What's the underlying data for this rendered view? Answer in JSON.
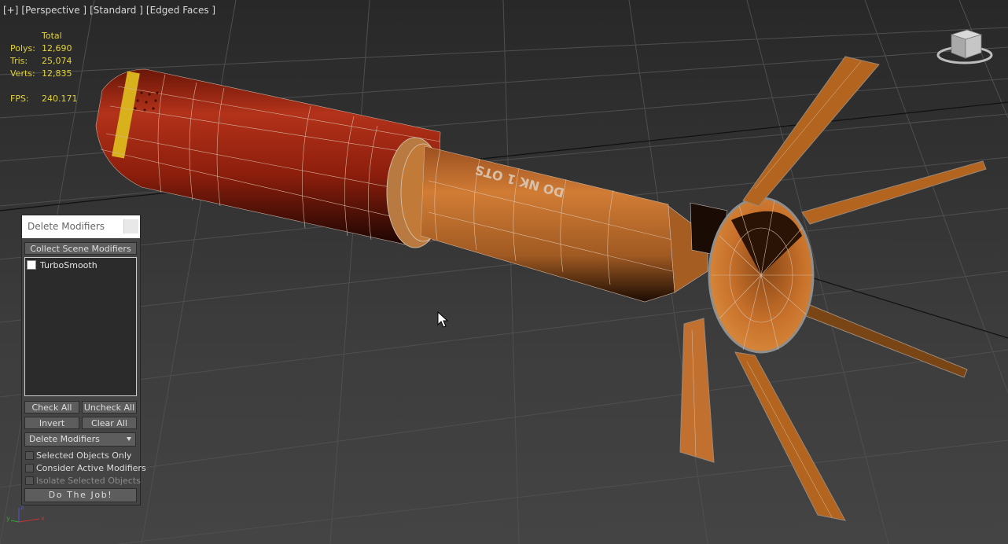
{
  "viewport": {
    "labels": [
      "[+]",
      "[Perspective ]",
      "[Standard ]",
      "[Edged Faces ]"
    ],
    "stats": {
      "header": "Total",
      "rows": [
        {
          "label": "Polys:",
          "value": "12,690"
        },
        {
          "label": "Tris:",
          "value": "25,074"
        },
        {
          "label": "Verts:",
          "value": "12,835"
        }
      ],
      "fps_label": "FPS:",
      "fps_value": "240.171"
    },
    "axis": {
      "x": "x",
      "y": "y",
      "z": "z"
    }
  },
  "model": {
    "label_text": "DO NK 1 OTS"
  },
  "panel": {
    "title": "Delete Modifiers",
    "collect_label": "Collect Scene Modifiers",
    "list_items": [
      {
        "label": "TurboSmooth",
        "checked": false
      }
    ],
    "check_all_label": "Check All",
    "uncheck_all_label": "Uncheck All",
    "invert_label": "Invert",
    "clear_all_label": "Clear All",
    "mode_selected": "Delete Modifiers",
    "options": [
      {
        "label": "Selected Objects Only",
        "checked": false,
        "enabled": true
      },
      {
        "label": "Consider Active Modifiers",
        "checked": false,
        "enabled": true
      },
      {
        "label": "Isolate Selected Objects",
        "checked": false,
        "enabled": false
      }
    ],
    "do_job_label": "Do The Job!"
  },
  "colors": {
    "stats_text": "#e2d23a",
    "body_red": "#a82a12",
    "band_yellow": "#d9b11c",
    "tube_orange": "#c9722e",
    "fin_orange": "#b3641f"
  }
}
